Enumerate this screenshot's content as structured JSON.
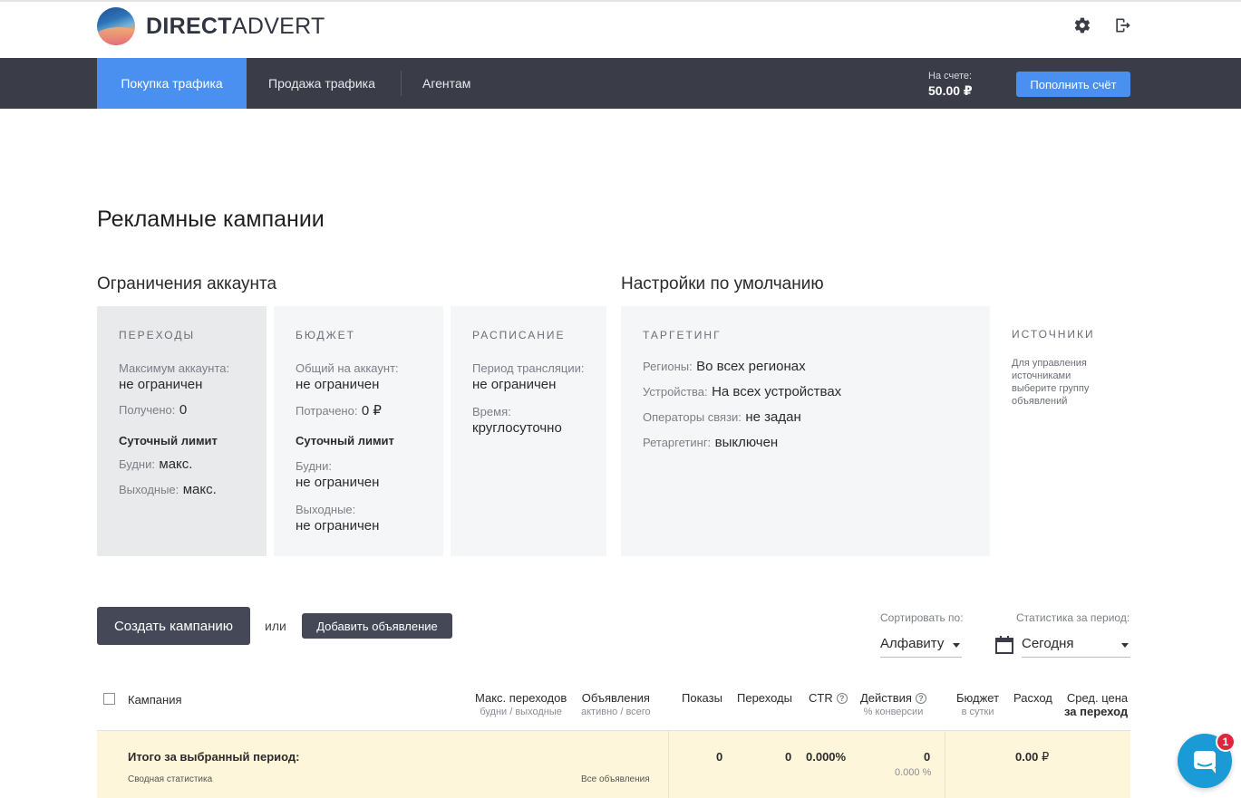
{
  "header": {
    "brand_bold": "DIRECT",
    "brand_light": "ADVERT"
  },
  "nav": {
    "tabs": [
      {
        "label": "Покупка трафика",
        "active": true
      },
      {
        "label": "Продажа трафика",
        "active": false
      },
      {
        "label": "Агентам",
        "active": false
      }
    ],
    "balance_label": "На счете:",
    "balance_value": "50.00 ₽",
    "topup_label": "Пополнить счёт",
    "accent_color": "#4a90f0"
  },
  "page_title": "Рекламные кампании",
  "limits": {
    "title": "Ограничения аккаунта",
    "clicks": {
      "heading": "ПЕРЕХОДЫ",
      "max_label": "Максимум аккаунта:",
      "max_value": "не ограничен",
      "received_label": "Получено:",
      "received_value": "0",
      "daily_label": "Суточный лимит",
      "weekdays_label": "Будни:",
      "weekdays_value": "макс.",
      "weekends_label": "Выходные:",
      "weekends_value": "макс."
    },
    "budget": {
      "heading": "БЮДЖЕТ",
      "total_label": "Общий на аккаунт:",
      "total_value": "не ограничен",
      "spent_label": "Потрачено:",
      "spent_value": "0 ₽",
      "daily_label": "Суточный лимит",
      "weekdays_label": "Будни:",
      "weekdays_value": "не ограничен",
      "weekends_label": "Выходные:",
      "weekends_value": "не ограничен"
    },
    "schedule": {
      "heading": "РАСПИСАНИЕ",
      "period_label": "Период трансляции:",
      "period_value": "не ограничен",
      "time_label": "Время:",
      "time_value": "круглосуточно"
    }
  },
  "defaults": {
    "title": "Настройки по умолчанию",
    "targeting": {
      "heading": "ТАРГЕТИНГ",
      "regions_label": "Регионы:",
      "regions_value": "Во всех регионах",
      "devices_label": "Устройства:",
      "devices_value": "На всех устройствах",
      "carriers_label": "Операторы связи:",
      "carriers_value": "не задан",
      "retargeting_label": "Ретаргетинг:",
      "retargeting_value": "выключен"
    },
    "sources": {
      "heading": "ИСТОЧНИКИ",
      "note": "Для управления источниками выберите группу объявлений"
    }
  },
  "actions": {
    "create_campaign": "Создать кампанию",
    "or": "или",
    "add_ad": "Добавить объявление",
    "sort_label": "Сортировать по:",
    "sort_value": "Алфавиту",
    "period_label": "Статистика за период:",
    "period_value": "Сегодня"
  },
  "table": {
    "columns": {
      "campaign": "Кампания",
      "max_clicks": "Макс. переходов",
      "max_clicks_sub": "будни / выходные",
      "ads": "Объявления",
      "ads_sub": "активно / всего",
      "impressions": "Показы",
      "clicks": "Переходы",
      "ctr": "CTR",
      "actions": "Действия",
      "actions_sub": "% конверсии",
      "budget": "Бюджет",
      "budget_sub": "в сутки",
      "spend": "Расход",
      "avg_price_1": "Сред. цена",
      "avg_price_2": "за переход"
    },
    "total": {
      "title": "Итого за выбранный период:",
      "subtitle": "Сводная статистика",
      "ads_note": "Все объявления",
      "impressions": "0",
      "clicks": "0",
      "ctr": "0.000%",
      "actions": "0",
      "conversion": "0.000 %",
      "spend": "0.00",
      "currency": "₽"
    }
  },
  "chat": {
    "badge": "1"
  }
}
